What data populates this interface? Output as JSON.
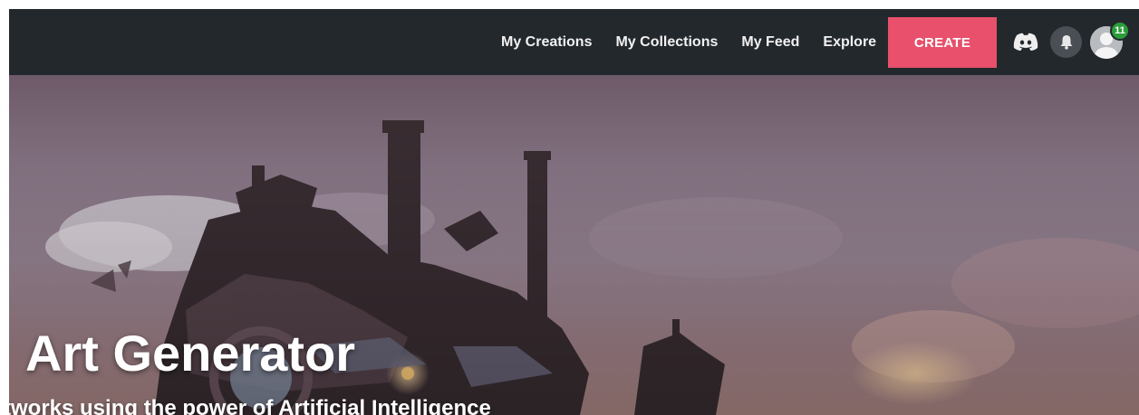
{
  "nav": {
    "links": [
      {
        "label": "My Creations"
      },
      {
        "label": "My Collections"
      },
      {
        "label": "My Feed"
      },
      {
        "label": "Explore"
      }
    ],
    "create_label": "CREATE",
    "notification_count": "11"
  },
  "hero": {
    "title": "Art Generator",
    "subtitle": "tworks using the power of Artificial Intelligence"
  },
  "icons": {
    "discord": "discord-icon",
    "bell": "bell-icon",
    "avatar": "user-avatar"
  },
  "colors": {
    "navbar": "#23282d",
    "create_button": "#e8506b",
    "badge": "#2a9d3a"
  }
}
